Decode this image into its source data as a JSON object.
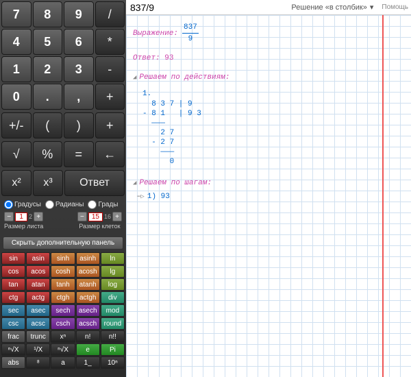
{
  "input": {
    "expression": "837/9"
  },
  "method": {
    "label": "Решение «в столбик»"
  },
  "keypad": {
    "rows": [
      [
        "7",
        "8",
        "9",
        "/"
      ],
      [
        "4",
        "5",
        "6",
        "*"
      ],
      [
        "1",
        "2",
        "3",
        "-"
      ],
      [
        "0",
        ".",
        ",",
        "+"
      ]
    ],
    "ops2": [
      "+/-",
      "(",
      ")",
      "+"
    ],
    "ops3": [
      "√",
      "%",
      "=",
      "←"
    ],
    "ans_row": [
      "x²",
      "x³",
      "Ответ"
    ]
  },
  "settings": {
    "angle_modes": [
      "Градусы",
      "Радианы",
      "Грады"
    ],
    "angle_selected": 0,
    "sheet_size": {
      "value": "1",
      "suffix": "2",
      "label": "Размер листа"
    },
    "cell_size": {
      "value": "15",
      "suffix": "16",
      "label": "Размер клеток"
    },
    "hide_panel": "Скрыть дополнительную панель"
  },
  "adv": [
    [
      {
        "t": "sin",
        "c": "c-red"
      },
      {
        "t": "asin",
        "c": "c-red"
      },
      {
        "t": "sinh",
        "c": "c-orange"
      },
      {
        "t": "asinh",
        "c": "c-orange"
      },
      {
        "t": "ln",
        "c": "c-olive"
      }
    ],
    [
      {
        "t": "cos",
        "c": "c-red"
      },
      {
        "t": "acos",
        "c": "c-red"
      },
      {
        "t": "cosh",
        "c": "c-orange"
      },
      {
        "t": "acosh",
        "c": "c-orange"
      },
      {
        "t": "lg",
        "c": "c-olive"
      }
    ],
    [
      {
        "t": "tan",
        "c": "c-red"
      },
      {
        "t": "atan",
        "c": "c-red"
      },
      {
        "t": "tanh",
        "c": "c-orange"
      },
      {
        "t": "atanh",
        "c": "c-orange"
      },
      {
        "t": "log",
        "c": "c-olive"
      }
    ],
    [
      {
        "t": "ctg",
        "c": "c-red"
      },
      {
        "t": "actg",
        "c": "c-red"
      },
      {
        "t": "ctgh",
        "c": "c-orange"
      },
      {
        "t": "actgh",
        "c": "c-orange"
      },
      {
        "t": "div",
        "c": "c-teal"
      }
    ],
    [
      {
        "t": "sec",
        "c": "c-blue"
      },
      {
        "t": "asec",
        "c": "c-blue"
      },
      {
        "t": "sech",
        "c": "c-purple"
      },
      {
        "t": "asech",
        "c": "c-purple"
      },
      {
        "t": "mod",
        "c": "c-teal"
      }
    ],
    [
      {
        "t": "csc",
        "c": "c-blue"
      },
      {
        "t": "acsc",
        "c": "c-blue"
      },
      {
        "t": "csch",
        "c": "c-purple"
      },
      {
        "t": "acsch",
        "c": "c-purple"
      },
      {
        "t": "round",
        "c": "c-teal"
      }
    ],
    [
      {
        "t": "frac",
        "c": "c-gray"
      },
      {
        "t": "trunc",
        "c": "c-gray"
      },
      {
        "t": "xⁿ",
        "c": "c-dark"
      },
      {
        "t": "n!",
        "c": "c-dark"
      },
      {
        "t": "n!!",
        "c": "c-dark"
      }
    ],
    [
      {
        "t": "ⁿ√X",
        "c": "c-dark"
      },
      {
        "t": "¹/X",
        "c": "c-dark"
      },
      {
        "t": "ⁿ√X",
        "c": "c-dark"
      },
      {
        "t": "e",
        "c": "c-green"
      },
      {
        "t": "Pi",
        "c": "c-green"
      }
    ],
    [
      {
        "t": "abs",
        "c": "c-gray"
      },
      {
        "t": "⁸",
        "c": "c-dark"
      },
      {
        "t": "a",
        "c": "c-dark"
      },
      {
        "t": "1_",
        "c": "c-dark"
      },
      {
        "t": "10ⁿ",
        "c": "c-dark"
      }
    ]
  ],
  "solution": {
    "expr_label": "Выражение:",
    "expr_num": "837",
    "expr_den": "9",
    "answer_label": "Ответ:",
    "answer_value": "93",
    "steps_label": "Решаем по действиям:",
    "step1_num": "1.",
    "longdiv_text": "  8 3 7 | 9\n- 8 1   | 9 3\n  ———\n    2 7\n  - 2 7\n    ———\n      0",
    "byturns_label": "Решаем по шагам:",
    "turn1": "1) 93"
  }
}
